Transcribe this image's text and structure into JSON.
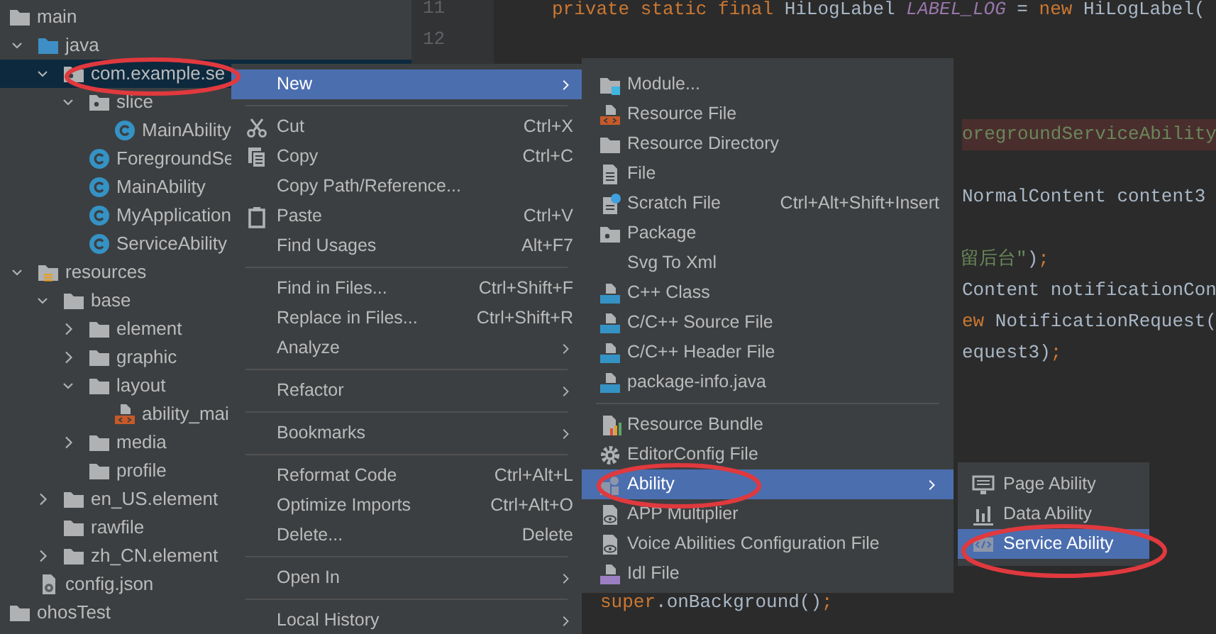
{
  "project_tree": [
    {
      "label": "main",
      "selected": false,
      "children": [
        {
          "label": "java",
          "expanded": true,
          "selected": false,
          "children": [
            {
              "label": "com.example.se",
              "expanded": true,
              "selected": true,
              "circled": true,
              "children": [
                {
                  "label": "slice",
                  "expanded": true,
                  "selected": false,
                  "children": [
                    {
                      "label": "MainAbility",
                      "selected": false
                    }
                  ]
                },
                {
                  "label": "ForegroundSe",
                  "selected": false
                },
                {
                  "label": "MainAbility",
                  "selected": false
                },
                {
                  "label": "MyApplication",
                  "selected": false
                },
                {
                  "label": "ServiceAbility",
                  "selected": false
                }
              ]
            }
          ]
        },
        {
          "label": "resources",
          "expanded": true,
          "selected": false,
          "children": [
            {
              "label": "base",
              "expanded": true,
              "selected": false,
              "children": [
                {
                  "label": "element",
                  "expanded": false,
                  "selected": false
                },
                {
                  "label": "graphic",
                  "expanded": false,
                  "selected": false
                },
                {
                  "label": "layout",
                  "expanded": true,
                  "selected": false,
                  "children": [
                    {
                      "label": "ability_mai",
                      "selected": false
                    }
                  ]
                },
                {
                  "label": "media",
                  "expanded": false,
                  "selected": false
                },
                {
                  "label": "profile",
                  "selected": false
                }
              ]
            },
            {
              "label": "en_US.element",
              "expanded": false,
              "selected": false
            },
            {
              "label": "rawfile",
              "selected": false
            },
            {
              "label": "zh_CN.element",
              "expanded": false,
              "selected": false
            }
          ]
        },
        {
          "label": "config.json",
          "selected": false
        }
      ]
    },
    {
      "label": "ohosTest",
      "selected": false
    }
  ],
  "editor": {
    "line_numbers": [
      "11",
      "12"
    ],
    "lines": [
      {
        "tokens": [
          {
            "kind": "keyword",
            "text": "private static final "
          },
          {
            "kind": "plain",
            "text": "HiLogLabel "
          },
          {
            "kind": "constant",
            "text": "LABEL_LOG"
          },
          {
            "kind": "plain",
            "text": " = "
          },
          {
            "kind": "keyword",
            "text": "new "
          },
          {
            "kind": "plain",
            "text": "HiLogLabel("
          }
        ]
      },
      {
        "highlighted": true,
        "tokens": [
          {
            "kind": "string",
            "text": "oregroundServiceAbility"
          }
        ]
      },
      {
        "tokens": [
          {
            "kind": "plain",
            "text": "NormalContent content3"
          }
        ]
      },
      {
        "tokens": [
          {
            "kind": "string",
            "text": "留后台\""
          },
          {
            "kind": "plain",
            "text": ")"
          },
          {
            "kind": "keyword",
            "text": ";"
          }
        ]
      },
      {
        "tokens": [
          {
            "kind": "plain",
            "text": "Content notificationCon"
          }
        ]
      },
      {
        "tokens": [
          {
            "kind": "keyword",
            "text": "ew"
          },
          {
            "kind": "plain",
            "text": " NotificationRequest("
          }
        ]
      },
      {
        "tokens": [
          {
            "kind": "plain",
            "text": "equest3)"
          },
          {
            "kind": "keyword",
            "text": ";"
          }
        ]
      },
      {
        "tokens": [
          {
            "kind": "keyword",
            "text": "super"
          },
          {
            "kind": "plain",
            "text": ".onBackground()"
          },
          {
            "kind": "keyword",
            "text": ";"
          }
        ]
      }
    ]
  },
  "context_menu": {
    "items": [
      {
        "kind": "item",
        "label": "New",
        "selected": true,
        "has_submenu": true
      },
      {
        "kind": "separator"
      },
      {
        "kind": "item",
        "label": "Cut",
        "shortcut": "Ctrl+X",
        "selected": false
      },
      {
        "kind": "item",
        "label": "Copy",
        "shortcut": "Ctrl+C",
        "selected": false
      },
      {
        "kind": "item",
        "label": "Copy Path/Reference...",
        "selected": false
      },
      {
        "kind": "item",
        "label": "Paste",
        "shortcut": "Ctrl+V",
        "selected": false
      },
      {
        "kind": "item",
        "label": "Find Usages",
        "shortcut": "Alt+F7",
        "selected": false
      },
      {
        "kind": "separator"
      },
      {
        "kind": "item",
        "label": "Find in Files...",
        "shortcut": "Ctrl+Shift+F",
        "selected": false
      },
      {
        "kind": "item",
        "label": "Replace in Files...",
        "shortcut": "Ctrl+Shift+R",
        "selected": false
      },
      {
        "kind": "item",
        "label": "Analyze",
        "selected": false,
        "has_submenu": true
      },
      {
        "kind": "separator"
      },
      {
        "kind": "item",
        "label": "Refactor",
        "selected": false,
        "has_submenu": true
      },
      {
        "kind": "separator"
      },
      {
        "kind": "item",
        "label": "Bookmarks",
        "selected": false,
        "has_submenu": true
      },
      {
        "kind": "separator"
      },
      {
        "kind": "item",
        "label": "Reformat Code",
        "shortcut": "Ctrl+Alt+L",
        "selected": false
      },
      {
        "kind": "item",
        "label": "Optimize Imports",
        "shortcut": "Ctrl+Alt+O",
        "selected": false
      },
      {
        "kind": "item",
        "label": "Delete...",
        "shortcut": "Delete",
        "selected": false
      },
      {
        "kind": "separator"
      },
      {
        "kind": "item",
        "label": "Open In",
        "selected": false,
        "has_submenu": true
      },
      {
        "kind": "separator"
      },
      {
        "kind": "item",
        "label": "Local History",
        "selected": false,
        "has_submenu": true
      }
    ]
  },
  "new_submenu": {
    "items": [
      {
        "kind": "item",
        "label": "Module...",
        "selected": false
      },
      {
        "kind": "item",
        "label": "Resource File",
        "selected": false
      },
      {
        "kind": "item",
        "label": "Resource Directory",
        "selected": false
      },
      {
        "kind": "item",
        "label": "File",
        "selected": false
      },
      {
        "kind": "item",
        "label": "Scratch File",
        "shortcut": "Ctrl+Alt+Shift+Insert",
        "selected": false
      },
      {
        "kind": "item",
        "label": "Package",
        "selected": false
      },
      {
        "kind": "item",
        "label": "Svg To Xml",
        "selected": false
      },
      {
        "kind": "item",
        "label": "C++ Class",
        "selected": false
      },
      {
        "kind": "item",
        "label": "C/C++ Source File",
        "selected": false
      },
      {
        "kind": "item",
        "label": "C/C++ Header File",
        "selected": false
      },
      {
        "kind": "item",
        "label": "package-info.java",
        "selected": false
      },
      {
        "kind": "separator"
      },
      {
        "kind": "item",
        "label": "Resource Bundle",
        "selected": false
      },
      {
        "kind": "item",
        "label": "EditorConfig File",
        "selected": false
      },
      {
        "kind": "item",
        "label": "Ability",
        "selected": true,
        "has_submenu": true,
        "circled": true
      },
      {
        "kind": "item",
        "label": "APP Multiplier",
        "selected": false
      },
      {
        "kind": "item",
        "label": "Voice Abilities Configuration File",
        "selected": false
      },
      {
        "kind": "item",
        "label": "Idl File",
        "selected": false
      }
    ]
  },
  "ability_submenu": {
    "items": [
      {
        "kind": "item",
        "label": "Page Ability",
        "selected": false
      },
      {
        "kind": "item",
        "label": "Data Ability",
        "selected": false
      },
      {
        "kind": "item",
        "label": "Service Ability",
        "selected": true,
        "circled": true
      }
    ]
  }
}
